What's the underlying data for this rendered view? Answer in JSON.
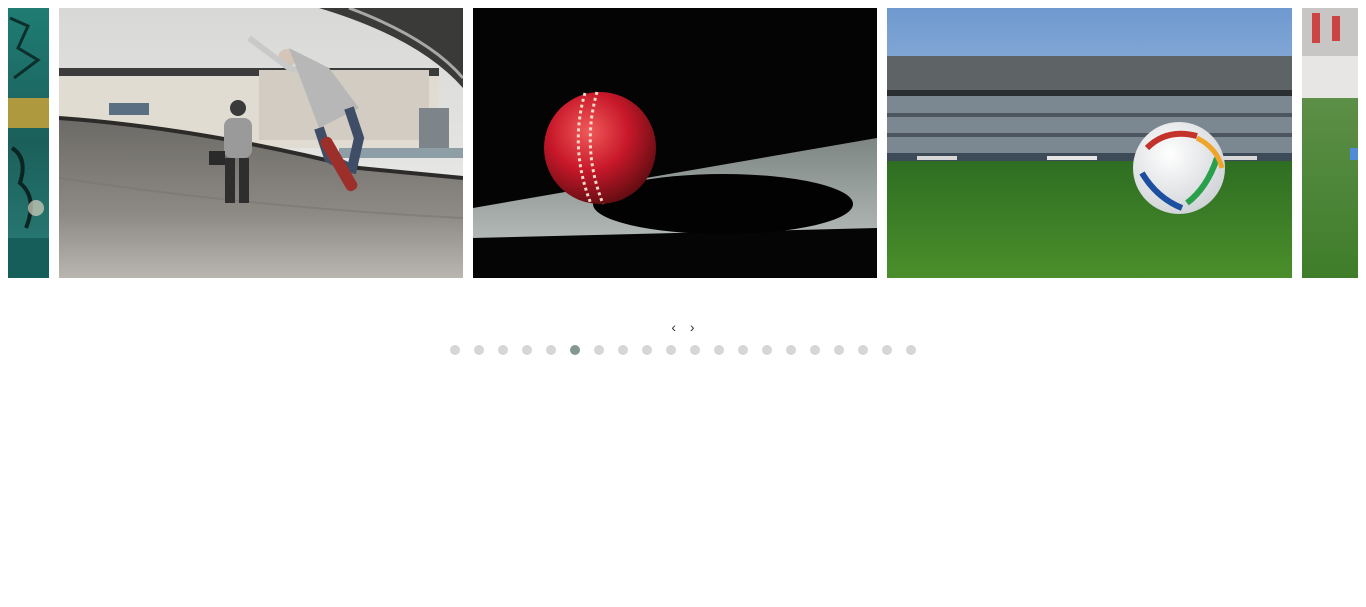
{
  "carousel": {
    "nav": {
      "prev_glyph": "‹",
      "next_glyph": "›"
    },
    "slides": [
      {
        "name": "graffiti-wall-partial",
        "description_icon": "image"
      },
      {
        "name": "skatepark-jump",
        "description_icon": "image"
      },
      {
        "name": "cricket-ball",
        "description_icon": "image"
      },
      {
        "name": "football-stadium",
        "description_icon": "image"
      },
      {
        "name": "football-pitch-partial",
        "description_icon": "image"
      }
    ],
    "dots_total": 20,
    "active_dot_index": 5,
    "colors": {
      "dot_inactive": "#d6d6d6",
      "dot_active": "#869791"
    }
  }
}
